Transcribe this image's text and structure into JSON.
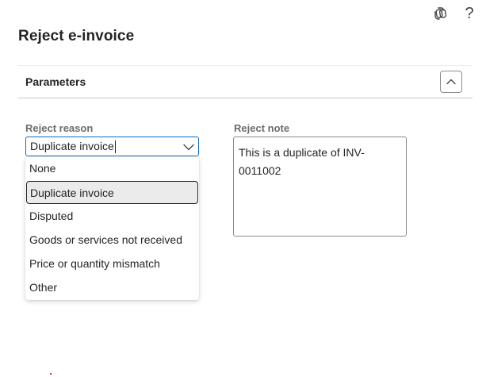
{
  "header": {
    "copilot_icon": "copilot-icon",
    "help_label": "?"
  },
  "dialog": {
    "title": "Reject e-invoice"
  },
  "section": {
    "title": "Parameters",
    "collapse_icon": "chevron-up-icon"
  },
  "reject_reason": {
    "label": "Reject reason",
    "value": "Duplicate invoice",
    "options": [
      "None",
      "Duplicate invoice",
      "Disputed",
      "Goods or services not received",
      "Price or quantity mismatch",
      "Other"
    ],
    "selected_index": 1
  },
  "reject_note": {
    "label": "Reject note",
    "value": "This is a duplicate of INV-0011002"
  },
  "colors": {
    "accent": "#0f6cbd",
    "selected_bg": "#ebebeb",
    "label_gray": "#6b6b6b"
  }
}
